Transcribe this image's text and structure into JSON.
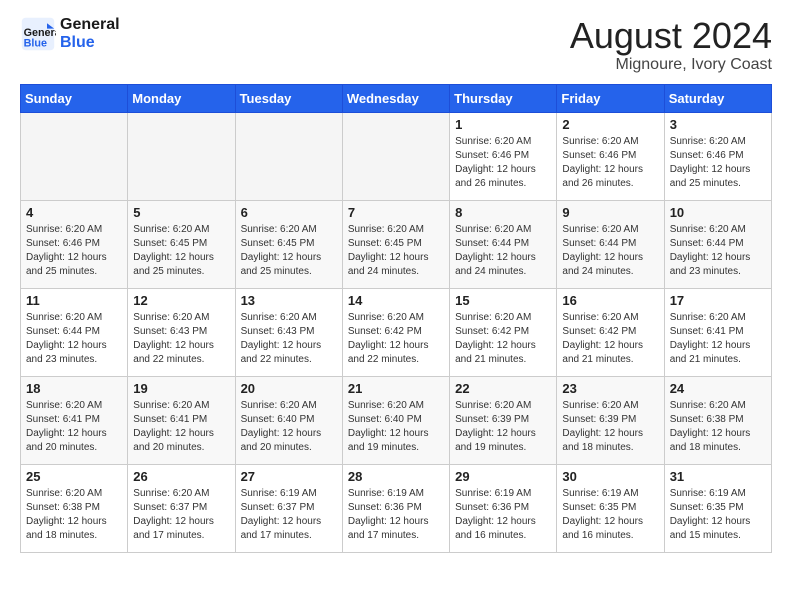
{
  "header": {
    "logo_line1": "General",
    "logo_line2": "Blue",
    "month_year": "August 2024",
    "location": "Mignoure, Ivory Coast"
  },
  "days_of_week": [
    "Sunday",
    "Monday",
    "Tuesday",
    "Wednesday",
    "Thursday",
    "Friday",
    "Saturday"
  ],
  "weeks": [
    [
      {
        "day": "",
        "empty": true
      },
      {
        "day": "",
        "empty": true
      },
      {
        "day": "",
        "empty": true
      },
      {
        "day": "",
        "empty": true
      },
      {
        "day": "1",
        "info": "Sunrise: 6:20 AM\nSunset: 6:46 PM\nDaylight: 12 hours\nand 26 minutes."
      },
      {
        "day": "2",
        "info": "Sunrise: 6:20 AM\nSunset: 6:46 PM\nDaylight: 12 hours\nand 26 minutes."
      },
      {
        "day": "3",
        "info": "Sunrise: 6:20 AM\nSunset: 6:46 PM\nDaylight: 12 hours\nand 25 minutes."
      }
    ],
    [
      {
        "day": "4",
        "info": "Sunrise: 6:20 AM\nSunset: 6:46 PM\nDaylight: 12 hours\nand 25 minutes."
      },
      {
        "day": "5",
        "info": "Sunrise: 6:20 AM\nSunset: 6:45 PM\nDaylight: 12 hours\nand 25 minutes."
      },
      {
        "day": "6",
        "info": "Sunrise: 6:20 AM\nSunset: 6:45 PM\nDaylight: 12 hours\nand 25 minutes."
      },
      {
        "day": "7",
        "info": "Sunrise: 6:20 AM\nSunset: 6:45 PM\nDaylight: 12 hours\nand 24 minutes."
      },
      {
        "day": "8",
        "info": "Sunrise: 6:20 AM\nSunset: 6:44 PM\nDaylight: 12 hours\nand 24 minutes."
      },
      {
        "day": "9",
        "info": "Sunrise: 6:20 AM\nSunset: 6:44 PM\nDaylight: 12 hours\nand 24 minutes."
      },
      {
        "day": "10",
        "info": "Sunrise: 6:20 AM\nSunset: 6:44 PM\nDaylight: 12 hours\nand 23 minutes."
      }
    ],
    [
      {
        "day": "11",
        "info": "Sunrise: 6:20 AM\nSunset: 6:44 PM\nDaylight: 12 hours\nand 23 minutes."
      },
      {
        "day": "12",
        "info": "Sunrise: 6:20 AM\nSunset: 6:43 PM\nDaylight: 12 hours\nand 22 minutes."
      },
      {
        "day": "13",
        "info": "Sunrise: 6:20 AM\nSunset: 6:43 PM\nDaylight: 12 hours\nand 22 minutes."
      },
      {
        "day": "14",
        "info": "Sunrise: 6:20 AM\nSunset: 6:42 PM\nDaylight: 12 hours\nand 22 minutes."
      },
      {
        "day": "15",
        "info": "Sunrise: 6:20 AM\nSunset: 6:42 PM\nDaylight: 12 hours\nand 21 minutes."
      },
      {
        "day": "16",
        "info": "Sunrise: 6:20 AM\nSunset: 6:42 PM\nDaylight: 12 hours\nand 21 minutes."
      },
      {
        "day": "17",
        "info": "Sunrise: 6:20 AM\nSunset: 6:41 PM\nDaylight: 12 hours\nand 21 minutes."
      }
    ],
    [
      {
        "day": "18",
        "info": "Sunrise: 6:20 AM\nSunset: 6:41 PM\nDaylight: 12 hours\nand 20 minutes."
      },
      {
        "day": "19",
        "info": "Sunrise: 6:20 AM\nSunset: 6:41 PM\nDaylight: 12 hours\nand 20 minutes."
      },
      {
        "day": "20",
        "info": "Sunrise: 6:20 AM\nSunset: 6:40 PM\nDaylight: 12 hours\nand 20 minutes."
      },
      {
        "day": "21",
        "info": "Sunrise: 6:20 AM\nSunset: 6:40 PM\nDaylight: 12 hours\nand 19 minutes."
      },
      {
        "day": "22",
        "info": "Sunrise: 6:20 AM\nSunset: 6:39 PM\nDaylight: 12 hours\nand 19 minutes."
      },
      {
        "day": "23",
        "info": "Sunrise: 6:20 AM\nSunset: 6:39 PM\nDaylight: 12 hours\nand 18 minutes."
      },
      {
        "day": "24",
        "info": "Sunrise: 6:20 AM\nSunset: 6:38 PM\nDaylight: 12 hours\nand 18 minutes."
      }
    ],
    [
      {
        "day": "25",
        "info": "Sunrise: 6:20 AM\nSunset: 6:38 PM\nDaylight: 12 hours\nand 18 minutes."
      },
      {
        "day": "26",
        "info": "Sunrise: 6:20 AM\nSunset: 6:37 PM\nDaylight: 12 hours\nand 17 minutes."
      },
      {
        "day": "27",
        "info": "Sunrise: 6:19 AM\nSunset: 6:37 PM\nDaylight: 12 hours\nand 17 minutes."
      },
      {
        "day": "28",
        "info": "Sunrise: 6:19 AM\nSunset: 6:36 PM\nDaylight: 12 hours\nand 17 minutes."
      },
      {
        "day": "29",
        "info": "Sunrise: 6:19 AM\nSunset: 6:36 PM\nDaylight: 12 hours\nand 16 minutes."
      },
      {
        "day": "30",
        "info": "Sunrise: 6:19 AM\nSunset: 6:35 PM\nDaylight: 12 hours\nand 16 minutes."
      },
      {
        "day": "31",
        "info": "Sunrise: 6:19 AM\nSunset: 6:35 PM\nDaylight: 12 hours\nand 15 minutes."
      }
    ]
  ]
}
